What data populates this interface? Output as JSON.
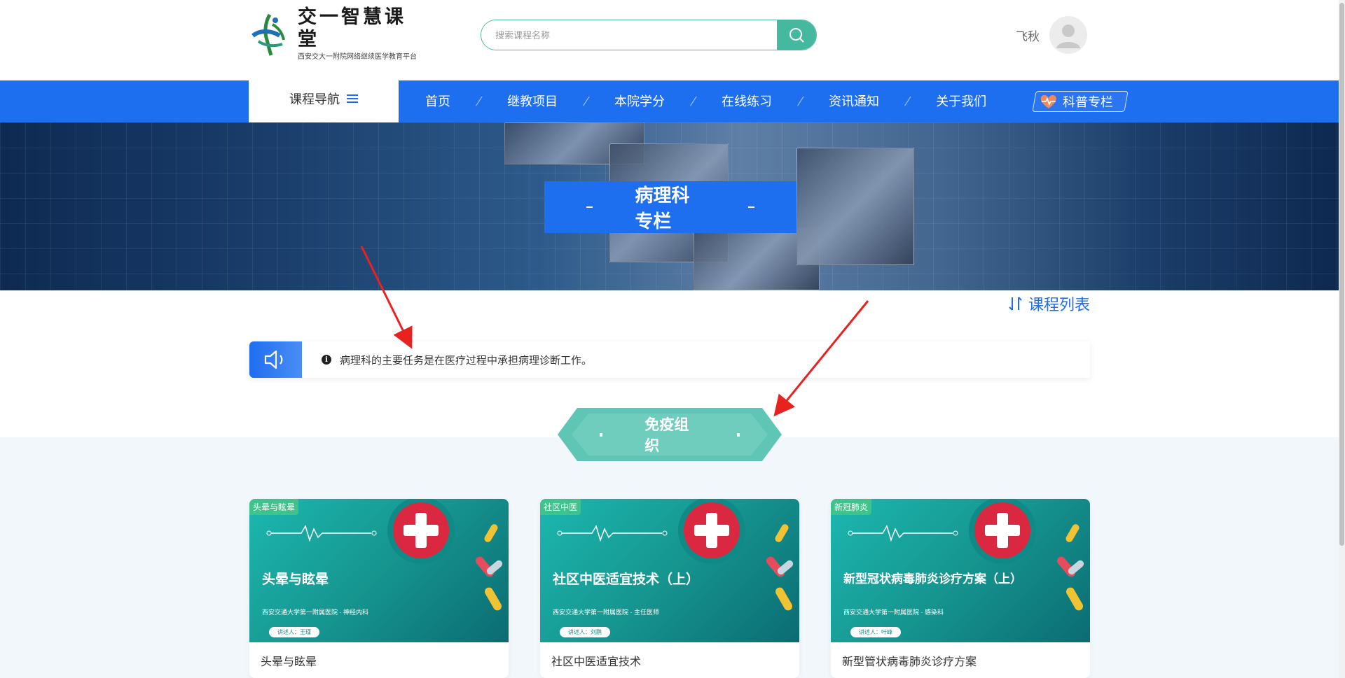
{
  "header": {
    "logo": {
      "title": "交一智慧课堂",
      "subtitle": "西安交大一附院网络继续医学教育平台"
    },
    "search": {
      "placeholder": "搜索课程名称"
    },
    "user": {
      "name": "飞秋"
    }
  },
  "nav": {
    "course_nav_label": "课程导航",
    "items": [
      "首页",
      "继教项目",
      "本院学分",
      "在线练习",
      "资讯通知",
      "关于我们"
    ],
    "special_label": "科普专栏"
  },
  "banner": {
    "title": "病理科专栏"
  },
  "course_list_link": "课程列表",
  "notice": {
    "text": "病理科的主要任务是在医疗过程中承担病理诊断工作。"
  },
  "section": {
    "title": "免疫组织"
  },
  "cards": [
    {
      "tag": "头晕与眩晕",
      "poster_title": "头晕与眩晕",
      "poster_subtitle": "西安交通大学第一附属医院 · 神经内科",
      "speaker": "讲述人：王瑾",
      "name": "头晕与眩晕"
    },
    {
      "tag": "社区中医",
      "poster_title": "社区中医适宜技术（上）",
      "poster_subtitle": "西安交通大学第一附属医院 · 主任医师",
      "speaker": "讲述人：刘鹏",
      "name": "社区中医适宜技术"
    },
    {
      "tag": "新冠肺炎",
      "poster_title": "新型冠状病毒肺炎诊疗方案（上）",
      "poster_subtitle": "西安交通大学第一附属医院 · 感染科",
      "speaker": "讲述人：叶峰",
      "name": "新型管状病毒肺炎诊疗方案"
    }
  ],
  "colors": {
    "primary": "#1e6ef0",
    "teal": "#45b9a0",
    "section_teal": "#5fc6b5",
    "annotation_red": "#e8221f"
  }
}
